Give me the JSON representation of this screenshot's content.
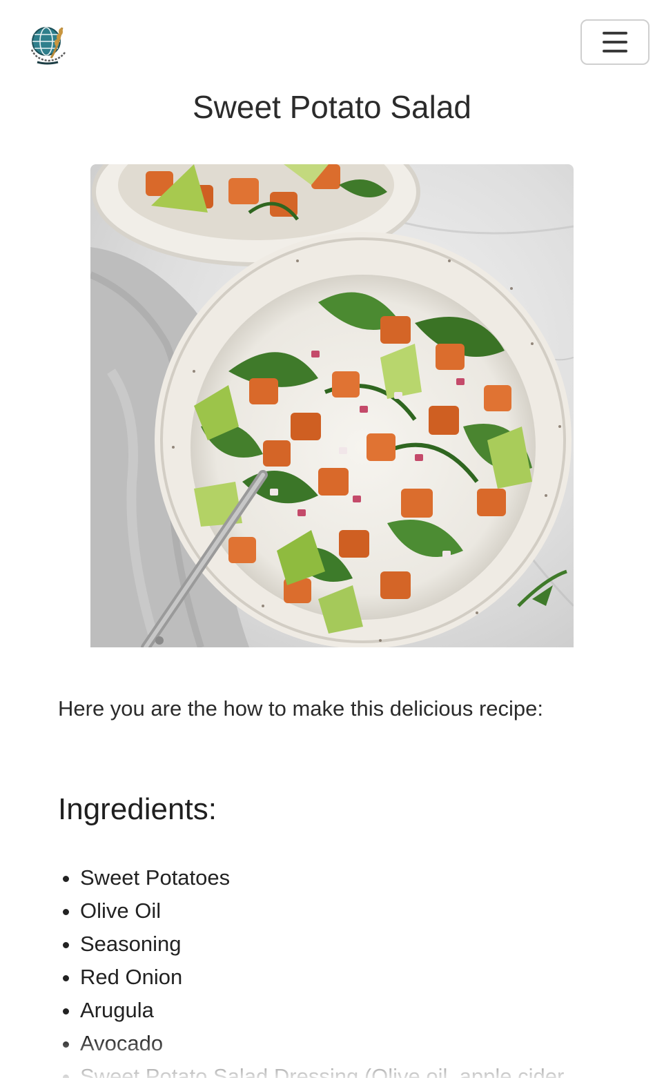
{
  "header": {
    "logo_icon": "globe-wheat-logo-icon",
    "menu_icon": "hamburger-menu-icon"
  },
  "recipe": {
    "title": "Sweet Potato Salad",
    "image_subject": "sweet-potato-salad-bowl-image",
    "intro": "Here you are the how to make this delicious recipe:",
    "ingredients_heading": "Ingredients:",
    "ingredients": [
      "Sweet Potatoes",
      "Olive Oil",
      "Seasoning",
      "Red Onion",
      "Arugula",
      "Avocado",
      "Sweet Potato Salad Dressing (Olive oil, apple cider"
    ]
  },
  "colors": {
    "text": "#2b2b2b",
    "border": "#cfcfcf",
    "sweet_potato": "#d9692a",
    "arugula": "#3f7a2a",
    "avocado": "#9cc44a"
  }
}
